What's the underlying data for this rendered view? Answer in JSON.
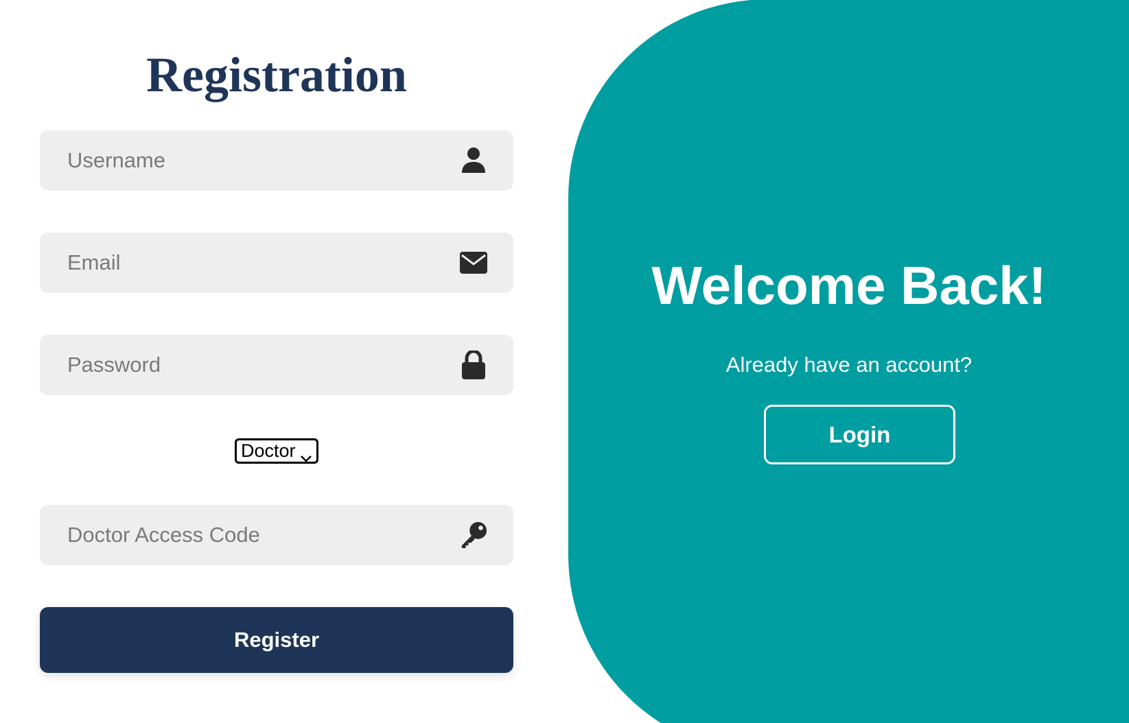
{
  "registration": {
    "title": "Registration",
    "username": {
      "placeholder": "Username",
      "icon": "user-icon"
    },
    "email": {
      "placeholder": "Email",
      "icon": "envelope-icon"
    },
    "password": {
      "placeholder": "Password",
      "icon": "lock-icon"
    },
    "role_select": {
      "selected": "Doctor"
    },
    "access_code": {
      "placeholder": "Doctor Access Code",
      "icon": "key-icon"
    },
    "register_label": "Register"
  },
  "welcome": {
    "title": "Welcome Back!",
    "subtitle": "Already have an account?",
    "login_label": "Login"
  },
  "colors": {
    "brand_navy": "#1f3558",
    "brand_teal": "#009da1",
    "field_bg": "#eeeeee"
  }
}
